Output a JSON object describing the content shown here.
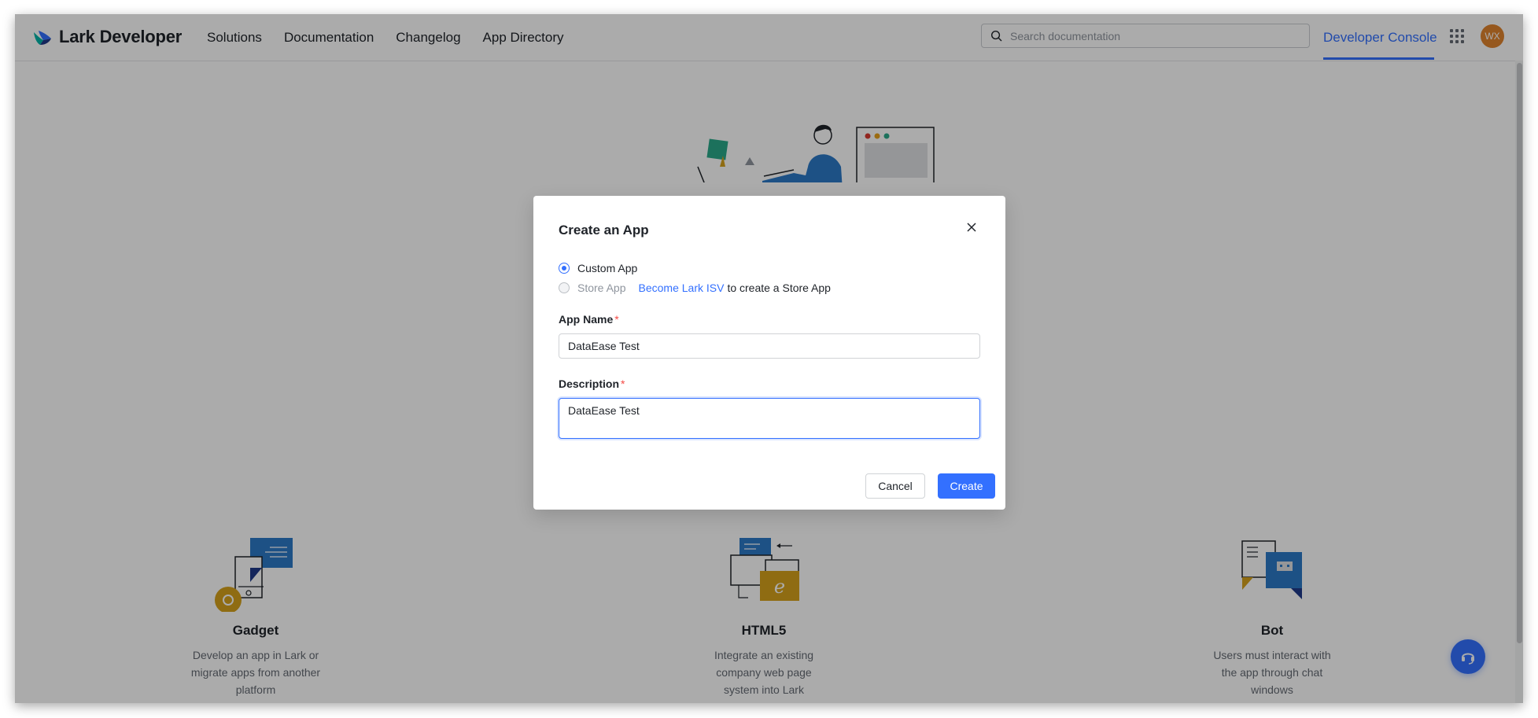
{
  "brand": {
    "name": "Lark Developer"
  },
  "nav": {
    "items": [
      {
        "label": "Solutions"
      },
      {
        "label": "Documentation"
      },
      {
        "label": "Changelog"
      },
      {
        "label": "App Directory"
      }
    ]
  },
  "search": {
    "placeholder": "Search documentation",
    "icon": "search-icon"
  },
  "header": {
    "developer_console": "Developer Console",
    "avatar_initials": "WX"
  },
  "features": [
    {
      "title": "Gadget",
      "desc": [
        "Develop an app in Lark or",
        "migrate apps from another",
        "platform"
      ]
    },
    {
      "title": "HTML5",
      "desc": [
        "Integrate an existing",
        "company web page",
        "system into Lark"
      ]
    },
    {
      "title": "Bot",
      "desc": [
        "Users must interact with",
        "the app through chat",
        "windows"
      ]
    }
  ],
  "modal": {
    "title": "Create an App",
    "options": [
      {
        "label": "Custom App",
        "selected": true
      },
      {
        "label": "Store App",
        "selected": false,
        "disabled": true
      }
    ],
    "isv_link": "Become Lark ISV",
    "isv_suffix": "to create a Store App",
    "app_name": {
      "label": "App Name",
      "required_mark": "*",
      "value": "DataEase Test"
    },
    "description": {
      "label": "Description",
      "required_mark": "*",
      "value": "DataEase Test"
    },
    "cancel_label": "Cancel",
    "create_label": "Create"
  },
  "colors": {
    "accent": "#3370ff",
    "avatar": "#e0832d",
    "required": "#f54a45"
  }
}
